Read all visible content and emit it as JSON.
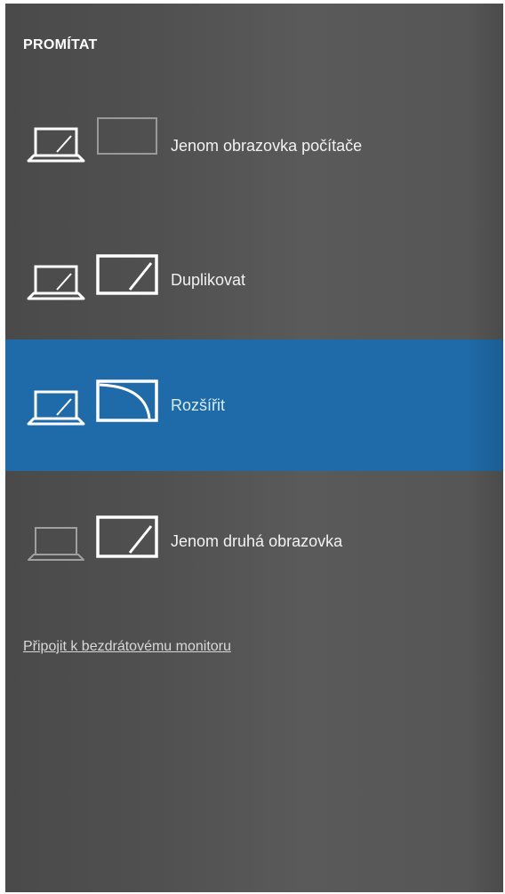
{
  "panel": {
    "title": "PROMÍTAT",
    "options": [
      {
        "label": "Jenom obrazovka počítače",
        "icon": "pc-screen-only-icon",
        "selected": false
      },
      {
        "label": "Duplikovat",
        "icon": "duplicate-icon",
        "selected": false
      },
      {
        "label": "Rozšířit",
        "icon": "extend-icon",
        "selected": true
      },
      {
        "label": "Jenom druhá obrazovka",
        "icon": "second-screen-only-icon",
        "selected": false
      }
    ],
    "wireless_link": "Připojit k bezdrátovému monitoru"
  },
  "colors": {
    "panel_background": "#505050",
    "selected_background": "#1f6aa8",
    "text": "#ffffff"
  }
}
